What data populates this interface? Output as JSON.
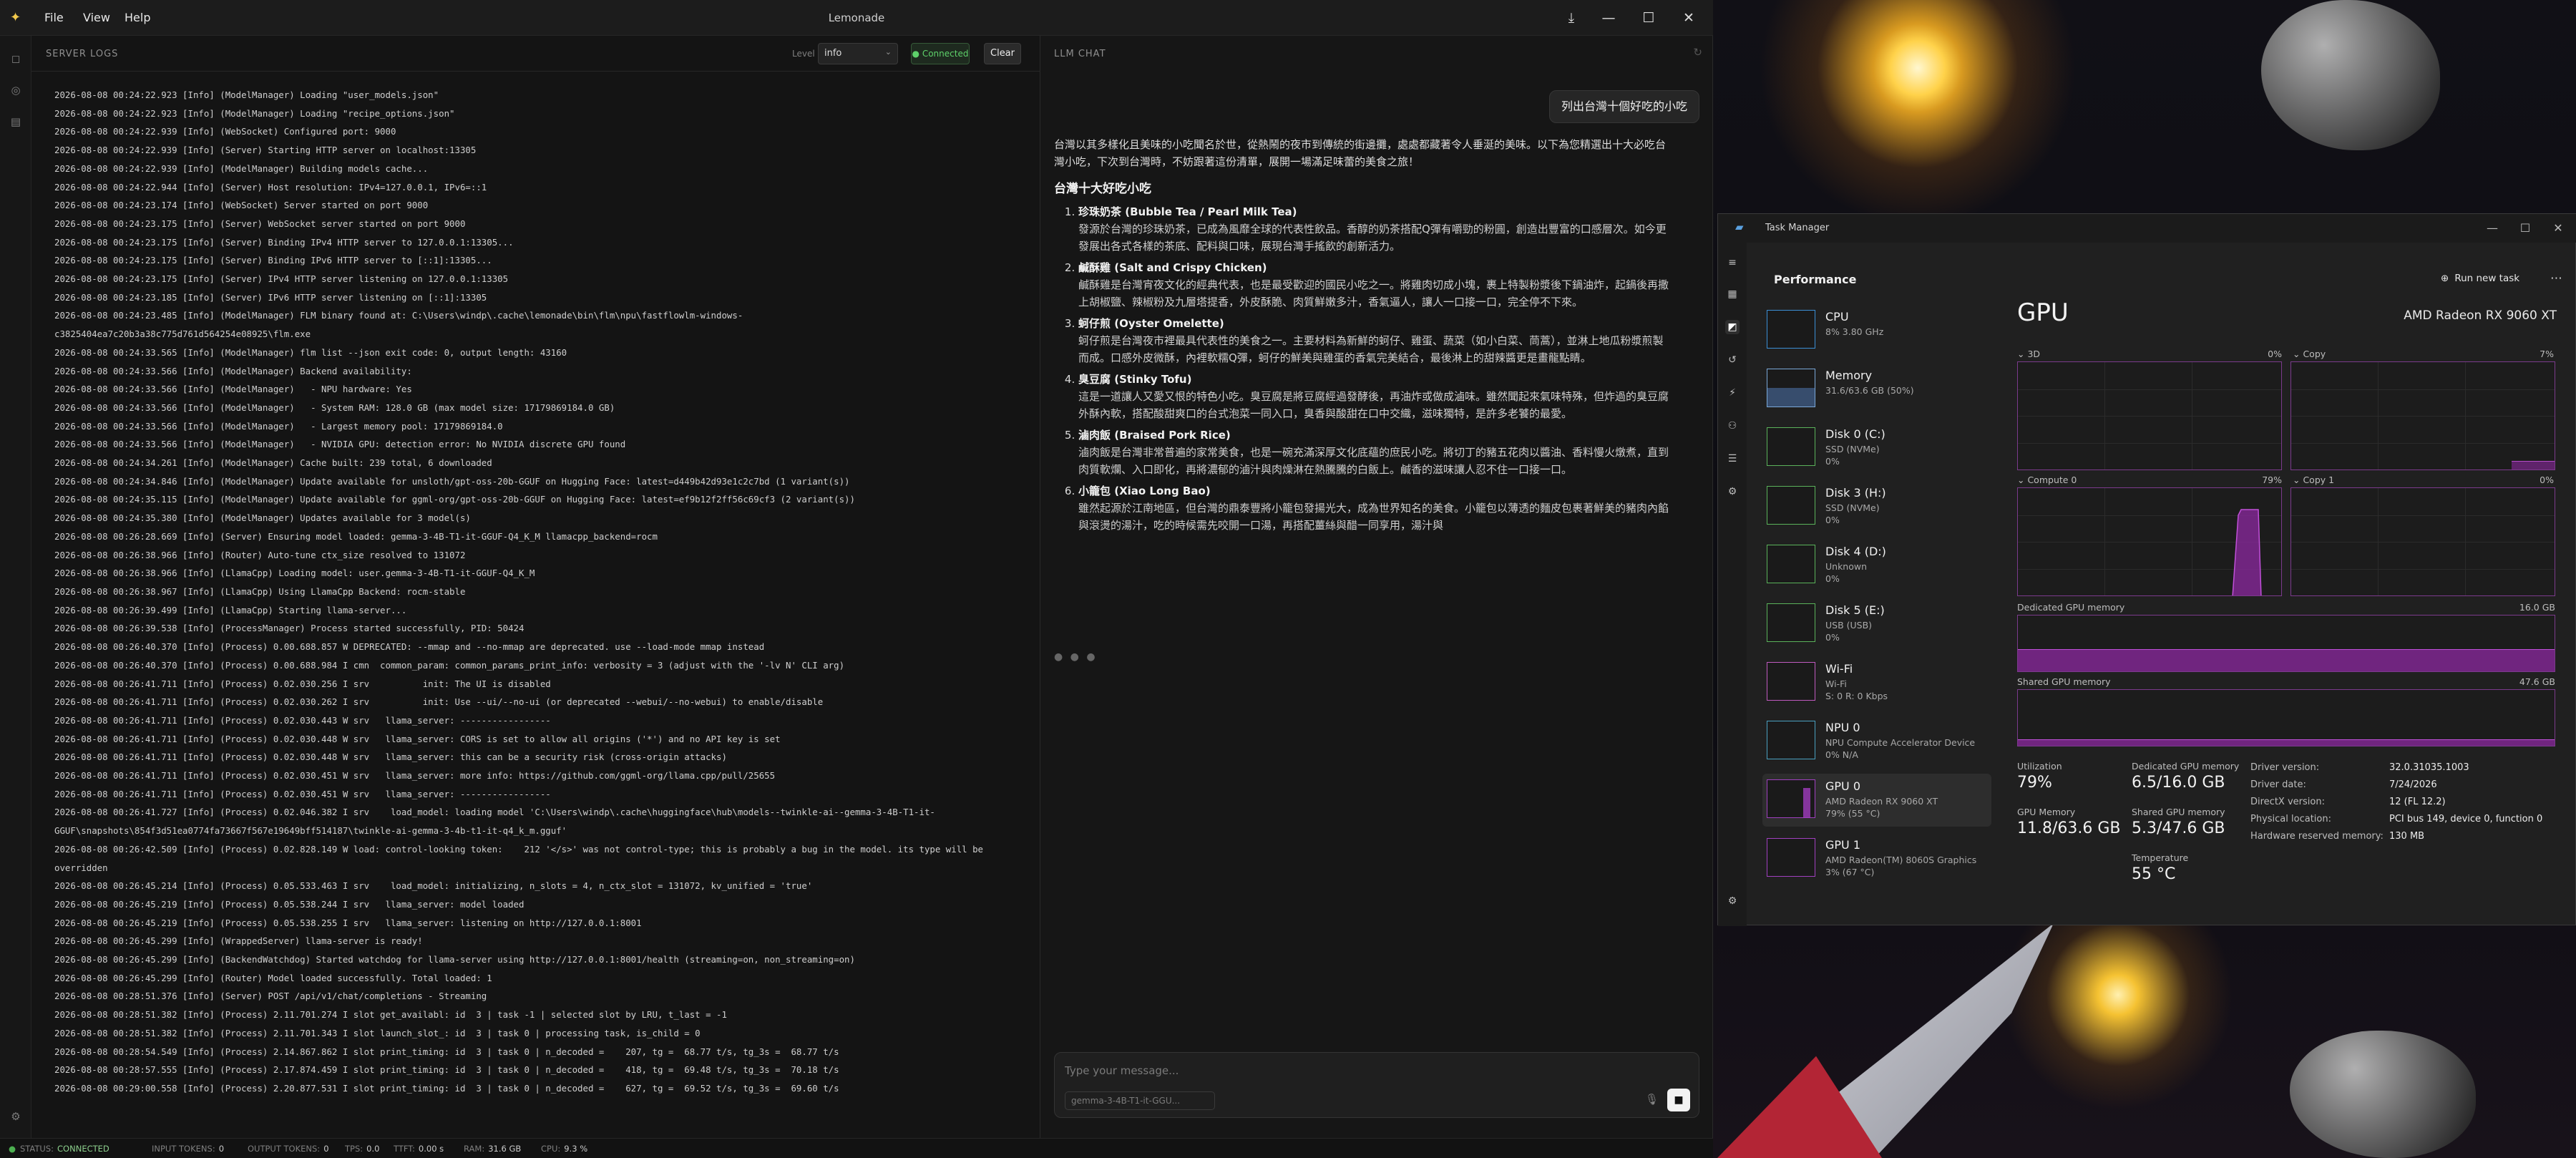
{
  "lemonade": {
    "title": "Lemonade",
    "menu": [
      "File",
      "View",
      "Help"
    ],
    "logs": {
      "header": "SERVER LOGS",
      "level_label": "Level",
      "level_value": "info",
      "connected_label": "● Connected",
      "clear_label": "Clear",
      "lines": [
        "2026-08-08 00:24:22.923 [Info] (ModelManager) Loading \"user_models.json\"",
        "2026-08-08 00:24:22.923 [Info] (ModelManager) Loading \"recipe_options.json\"",
        "2026-08-08 00:24:22.939 [Info] (WebSocket) Configured port: 9000",
        "2026-08-08 00:24:22.939 [Info] (Server) Starting HTTP server on localhost:13305",
        "2026-08-08 00:24:22.939 [Info] (ModelManager) Building models cache...",
        "2026-08-08 00:24:22.944 [Info] (Server) Host resolution: IPv4=127.0.0.1, IPv6=::1",
        "2026-08-08 00:24:23.174 [Info] (WebSocket) Server started on port 9000",
        "2026-08-08 00:24:23.175 [Info] (Server) WebSocket server started on port 9000",
        "2026-08-08 00:24:23.175 [Info] (Server) Binding IPv4 HTTP server to 127.0.0.1:13305...",
        "2026-08-08 00:24:23.175 [Info] (Server) Binding IPv6 HTTP server to [::1]:13305...",
        "2026-08-08 00:24:23.175 [Info] (Server) IPv4 HTTP server listening on 127.0.0.1:13305",
        "2026-08-08 00:24:23.185 [Info] (Server) IPv6 HTTP server listening on [::1]:13305",
        "2026-08-08 00:24:23.485 [Info] (ModelManager) FLM binary found at: C:\\Users\\windp\\.cache\\lemonade\\bin\\flm\\npu\\fastflowlm-windows-",
        "c3825404ea7c20b3a38c775d761d564254e08925\\flm.exe",
        "2026-08-08 00:24:33.565 [Info] (ModelManager) flm list --json exit code: 0, output length: 43160",
        "2026-08-08 00:24:33.566 [Info] (ModelManager) Backend availability:",
        "2026-08-08 00:24:33.566 [Info] (ModelManager)   - NPU hardware: Yes",
        "2026-08-08 00:24:33.566 [Info] (ModelManager)   - System RAM: 128.0 GB (max model size: 17179869184.0 GB)",
        "2026-08-08 00:24:33.566 [Info] (ModelManager)   - Largest memory pool: 17179869184.0",
        "2026-08-08 00:24:33.566 [Info] (ModelManager)   - NVIDIA GPU: detection error: No NVIDIA discrete GPU found",
        "2026-08-08 00:24:34.261 [Info] (ModelManager) Cache built: 239 total, 6 downloaded",
        "2026-08-08 00:24:34.846 [Info] (ModelManager) Update available for unsloth/gpt-oss-20b-GGUF on Hugging Face: latest=d449b42d93e1c2c7bd (1 variant(s))",
        "2026-08-08 00:24:35.115 [Info] (ModelManager) Update available for ggml-org/gpt-oss-20b-GGUF on Hugging Face: latest=ef9b12f2ff56c69cf3 (2 variant(s))",
        "2026-08-08 00:24:35.380 [Info] (ModelManager) Updates available for 3 model(s)",
        "2026-08-08 00:26:28.669 [Info] (Server) Ensuring model loaded: gemma-3-4B-T1-it-GGUF-Q4_K_M llamacpp_backend=rocm",
        "2026-08-08 00:26:38.966 [Info] (Router) Auto-tune ctx_size resolved to 131072",
        "2026-08-08 00:26:38.966 [Info] (LlamaCpp) Loading model: user.gemma-3-4B-T1-it-GGUF-Q4_K_M",
        "2026-08-08 00:26:38.967 [Info] (LlamaCpp) Using LlamaCpp Backend: rocm-stable",
        "2026-08-08 00:26:39.499 [Info] (LlamaCpp) Starting llama-server...",
        "2026-08-08 00:26:39.538 [Info] (ProcessManager) Process started successfully, PID: 50424",
        "2026-08-08 00:26:40.370 [Info] (Process) 0.00.688.857 W DEPRECATED: --mmap and --no-mmap are deprecated. use --load-mode mmap instead",
        "2026-08-08 00:26:40.370 [Info] (Process) 0.00.688.984 I cmn  common_param: common_params_print_info: verbosity = 3 (adjust with the '-lv N' CLI arg)",
        "2026-08-08 00:26:41.711 [Info] (Process) 0.02.030.256 I srv          init: The UI is disabled",
        "2026-08-08 00:26:41.711 [Info] (Process) 0.02.030.262 I srv          init: Use --ui/--no-ui (or deprecated --webui/--no-webui) to enable/disable",
        "2026-08-08 00:26:41.711 [Info] (Process) 0.02.030.443 W srv   llama_server: -----------------",
        "2026-08-08 00:26:41.711 [Info] (Process) 0.02.030.448 W srv   llama_server: CORS is set to allow all origins ('*') and no API key is set",
        "2026-08-08 00:26:41.711 [Info] (Process) 0.02.030.448 W srv   llama_server: this can be a security risk (cross-origin attacks)",
        "2026-08-08 00:26:41.711 [Info] (Process) 0.02.030.451 W srv   llama_server: more info: https://github.com/ggml-org/llama.cpp/pull/25655",
        "2026-08-08 00:26:41.711 [Info] (Process) 0.02.030.451 W srv   llama_server: -----------------",
        "2026-08-08 00:26:41.727 [Info] (Process) 0.02.046.382 I srv    load_model: loading model 'C:\\Users\\windp\\.cache\\huggingface\\hub\\models--twinkle-ai--gemma-3-4B-T1-it-",
        "GGUF\\snapshots\\854f3d51ea0774fa73667f567e19649bff514187\\twinkle-ai-gemma-3-4b-t1-it-q4_k_m.gguf'",
        "2026-08-08 00:26:42.509 [Info] (Process) 0.02.828.149 W load: control-looking token:    212 '</s>' was not control-type; this is probably a bug in the model. its type will be",
        "overridden",
        "2026-08-08 00:26:45.214 [Info] (Process) 0.05.533.463 I srv    load_model: initializing, n_slots = 4, n_ctx_slot = 131072, kv_unified = 'true'",
        "2026-08-08 00:26:45.219 [Info] (Process) 0.05.538.244 I srv   llama_server: model loaded",
        "2026-08-08 00:26:45.219 [Info] (Process) 0.05.538.255 I srv   llama_server: listening on http://127.0.0.1:8001",
        "2026-08-08 00:26:45.299 [Info] (WrappedServer) llama-server is ready!",
        "2026-08-08 00:26:45.299 [Info] (BackendWatchdog) Started watchdog for llama-server using http://127.0.0.1:8001/health (streaming=on, non_streaming=on)",
        "2026-08-08 00:26:45.299 [Info] (Router) Model loaded successfully. Total loaded: 1",
        "2026-08-08 00:28:51.376 [Info] (Server) POST /api/v1/chat/completions - Streaming",
        "2026-08-08 00:28:51.382 [Info] (Process) 2.11.701.274 I slot get_availabl: id  3 | task -1 | selected slot by LRU, t_last = -1",
        "2026-08-08 00:28:51.382 [Info] (Process) 2.11.701.343 I slot launch_slot_: id  3 | task 0 | processing task, is_child = 0",
        "2026-08-08 00:28:54.549 [Info] (Process) 2.14.867.862 I slot print_timing: id  3 | task 0 | n_decoded =    207, tg =  68.77 t/s, tg_3s =  68.77 t/s",
        "2026-08-08 00:28:57.555 [Info] (Process) 2.17.874.459 I slot print_timing: id  3 | task 0 | n_decoded =    418, tg =  69.48 t/s, tg_3s =  70.18 t/s",
        "2026-08-08 00:29:00.558 [Info] (Process) 2.20.877.531 I slot print_timing: id  3 | task 0 | n_decoded =    627, tg =  69.52 t/s, tg_3s =  69.60 t/s"
      ]
    },
    "chat": {
      "header": "LLM CHAT",
      "user_message": "列出台灣十個好吃的小吃",
      "intro": "台灣以其多樣化且美味的小吃聞名於世，從熱鬧的夜市到傳統的街邊攤，處處都藏著令人垂涎的美味。以下為您精選出十大必吃台灣小吃，下次到台灣時，不妨跟著這份清單，展開一場滿足味蕾的美食之旅！",
      "heading": "台灣十大好吃小吃",
      "items": [
        {
          "name": "珍珠奶茶 (Bubble Tea / Pearl Milk Tea)",
          "desc": "發源於台灣的珍珠奶茶，已成為風靡全球的代表性飲品。香醇的奶茶搭配Q彈有嚼勁的粉圓，創造出豐富的口感層次。如今更發展出各式各樣的茶底、配料與口味，展現台灣手搖飲的創新活力。"
        },
        {
          "name": "鹹酥雞 (Salt and Crispy Chicken)",
          "desc": "鹹酥雞是台灣宵夜文化的經典代表，也是最受歡迎的國民小吃之一。將雞肉切成小塊，裹上特製粉漿後下鍋油炸，起鍋後再撒上胡椒鹽、辣椒粉及九層塔提香，外皮酥脆、肉質鮮嫩多汁，香氣逼人，讓人一口接一口，完全停不下來。"
        },
        {
          "name": "蚵仔煎 (Oyster Omelette)",
          "desc": "蚵仔煎是台灣夜市裡最具代表性的美食之一。主要材料為新鮮的蚵仔、雞蛋、蔬菜（如小白菜、茼蒿），並淋上地瓜粉漿煎製而成。口感外皮微酥，內裡軟糯Q彈，蚵仔的鮮美與雞蛋的香氣完美結合，最後淋上的甜辣醬更是畫龍點睛。"
        },
        {
          "name": "臭豆腐 (Stinky Tofu)",
          "desc": "這是一道讓人又愛又恨的特色小吃。臭豆腐是將豆腐經過發酵後，再油炸或做成滷味。雖然聞起來氣味特殊，但炸過的臭豆腐外酥內軟，搭配酸甜爽口的台式泡菜一同入口，臭香與酸甜在口中交織，滋味獨特，是許多老饕的最愛。"
        },
        {
          "name": "滷肉飯 (Braised Pork Rice)",
          "desc": "滷肉飯是台灣非常普遍的家常美食，也是一碗充滿深厚文化底蘊的庶民小吃。將切丁的豬五花肉以醬油、香料慢火燉煮，直到肉質軟爛、入口即化，再將濃郁的滷汁與肉燥淋在熱騰騰的白飯上。鹹香的滋味讓人忍不住一口接一口。"
        },
        {
          "name": "小籠包 (Xiao Long Bao)",
          "desc": "雖然起源於江南地區，但台灣的鼎泰豐將小籠包發揚光大，成為世界知名的美食。小籠包以薄透的麵皮包裹著鮮美的豬肉內餡與滾燙的湯汁，吃的時候需先咬開一口湯，再搭配薑絲與醋一同享用，湯汁與"
        }
      ],
      "input_placeholder": "Type your message...",
      "model_chip": "gemma-3-4B-T1-it-GGU...",
      "typing": "● ● ●"
    },
    "status": {
      "status_label": "STATUS:",
      "status_value": "CONNECTED",
      "input_label": "INPUT TOKENS:",
      "input_value": "0",
      "output_label": "OUTPUT TOKENS:",
      "output_value": "0",
      "tps_label": "TPS:",
      "tps_value": "0.0",
      "ttft_label": "TTFT:",
      "ttft_value": "0.00 s",
      "ram_label": "RAM:",
      "ram_value": "31.6 GB",
      "cpu_label": "CPU:",
      "cpu_value": "9.3 %"
    }
  },
  "taskmgr": {
    "title": "Task Manager",
    "section": "Performance",
    "run_new_task": "Run new task",
    "devices": [
      {
        "name": "CPU",
        "sub1": "8% 3.80 GHz",
        "sub2": ""
      },
      {
        "name": "Memory",
        "sub1": "31.6/63.6 GB (50%)",
        "sub2": ""
      },
      {
        "name": "Disk 0 (C:)",
        "sub1": "SSD (NVMe)",
        "sub2": "0%"
      },
      {
        "name": "Disk 3 (H:)",
        "sub1": "SSD (NVMe)",
        "sub2": "0%"
      },
      {
        "name": "Disk 4 (D:)",
        "sub1": "Unknown",
        "sub2": "0%"
      },
      {
        "name": "Disk 5 (E:)",
        "sub1": "USB (USB)",
        "sub2": "0%"
      },
      {
        "name": "Wi-Fi",
        "sub1": "Wi-Fi",
        "sub2": "S: 0 R: 0 Kbps"
      },
      {
        "name": "NPU 0",
        "sub1": "NPU Compute Accelerator Device",
        "sub2": "0% N/A"
      },
      {
        "name": "GPU 0",
        "sub1": "AMD Radeon RX 9060 XT",
        "sub2": "79% (55 °C)"
      },
      {
        "name": "GPU 1",
        "sub1": "AMD Radeon(TM) 8060S Graphics",
        "sub2": "3% (67 °C)"
      }
    ],
    "gpu": {
      "title": "GPU",
      "model": "AMD Radeon RX 9060 XT",
      "engines": [
        {
          "name": "3D",
          "pct": "0%"
        },
        {
          "name": "Copy",
          "pct": "7%"
        },
        {
          "name": "Compute 0",
          "pct": "79%"
        },
        {
          "name": "Copy 1",
          "pct": "0%"
        }
      ],
      "dedicated_label": "Dedicated GPU memory",
      "dedicated_max": "16.0 GB",
      "shared_label": "Shared GPU memory",
      "shared_max": "47.6 GB",
      "stats": {
        "util_label": "Utilization",
        "util_value": "79%",
        "ded_label": "Dedicated GPU memory",
        "ded_value": "6.5/16.0 GB",
        "gpumem_label": "GPU Memory",
        "gpumem_value": "11.8/63.6 GB",
        "shared_label": "Shared GPU memory",
        "shared_value": "5.3/47.6 GB",
        "temp_label": "Temperature",
        "temp_value": "55 °C"
      },
      "info": [
        {
          "k": "Driver version:",
          "v": "32.0.31035.1003"
        },
        {
          "k": "Driver date:",
          "v": "7/24/2026"
        },
        {
          "k": "DirectX version:",
          "v": "12 (FL 12.2)"
        },
        {
          "k": "Physical location:",
          "v": "PCI bus 149, device 0, function 0"
        },
        {
          "k": "Hardware reserved memory:",
          "v": "130 MB"
        }
      ]
    }
  }
}
